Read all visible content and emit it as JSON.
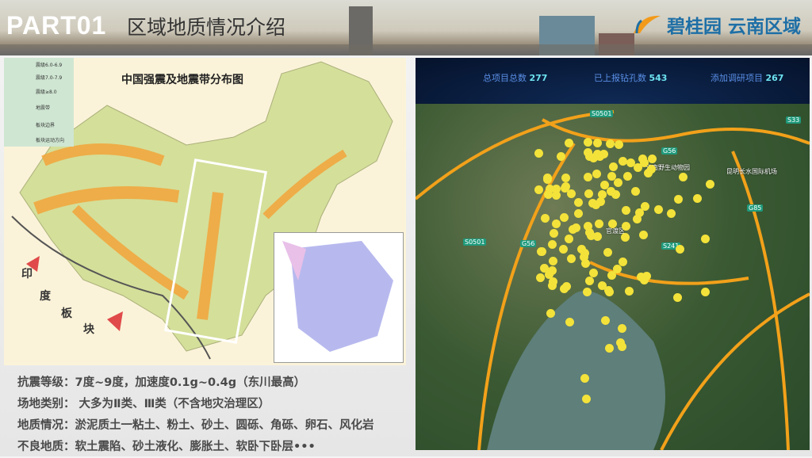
{
  "header": {
    "part": "PART01",
    "title": "区域地质情况介绍",
    "brand": "碧桂园 云南区域"
  },
  "left_map": {
    "title": "中国强震及地震带分布图",
    "legend": [
      "震级6.0-6.9",
      "震级7.0-7.9",
      "震级≥8.0",
      "地震带",
      "板块边界",
      "板块运动方向"
    ],
    "plate_label": [
      "印",
      "度",
      "板",
      "块"
    ]
  },
  "right_panel": {
    "stats": [
      {
        "label": "总项目总数",
        "value": "277"
      },
      {
        "label": "已上报钻孔数",
        "value": "543"
      },
      {
        "label": "添加调研项目",
        "value": "267"
      }
    ],
    "roads": [
      "S0501",
      "G56",
      "S0501",
      "G56",
      "S241",
      "G85",
      "S33"
    ],
    "places": [
      "官渡区",
      "云南野生动物园",
      "昆明长水国际机场"
    ]
  },
  "notes": [
    "抗震等级：7度~9度，加速度0.1g~0.4g（东川最高）",
    "场地类别： 大多为Ⅱ类、Ⅲ类（不含地灾治理区）",
    "地质情况：淤泥质土一粘土、粉土、砂土、圆砾、角砾、卵石、风化岩",
    "不良地质：软土震陷、砂土液化、膨胀土、软卧下卧层•••"
  ]
}
